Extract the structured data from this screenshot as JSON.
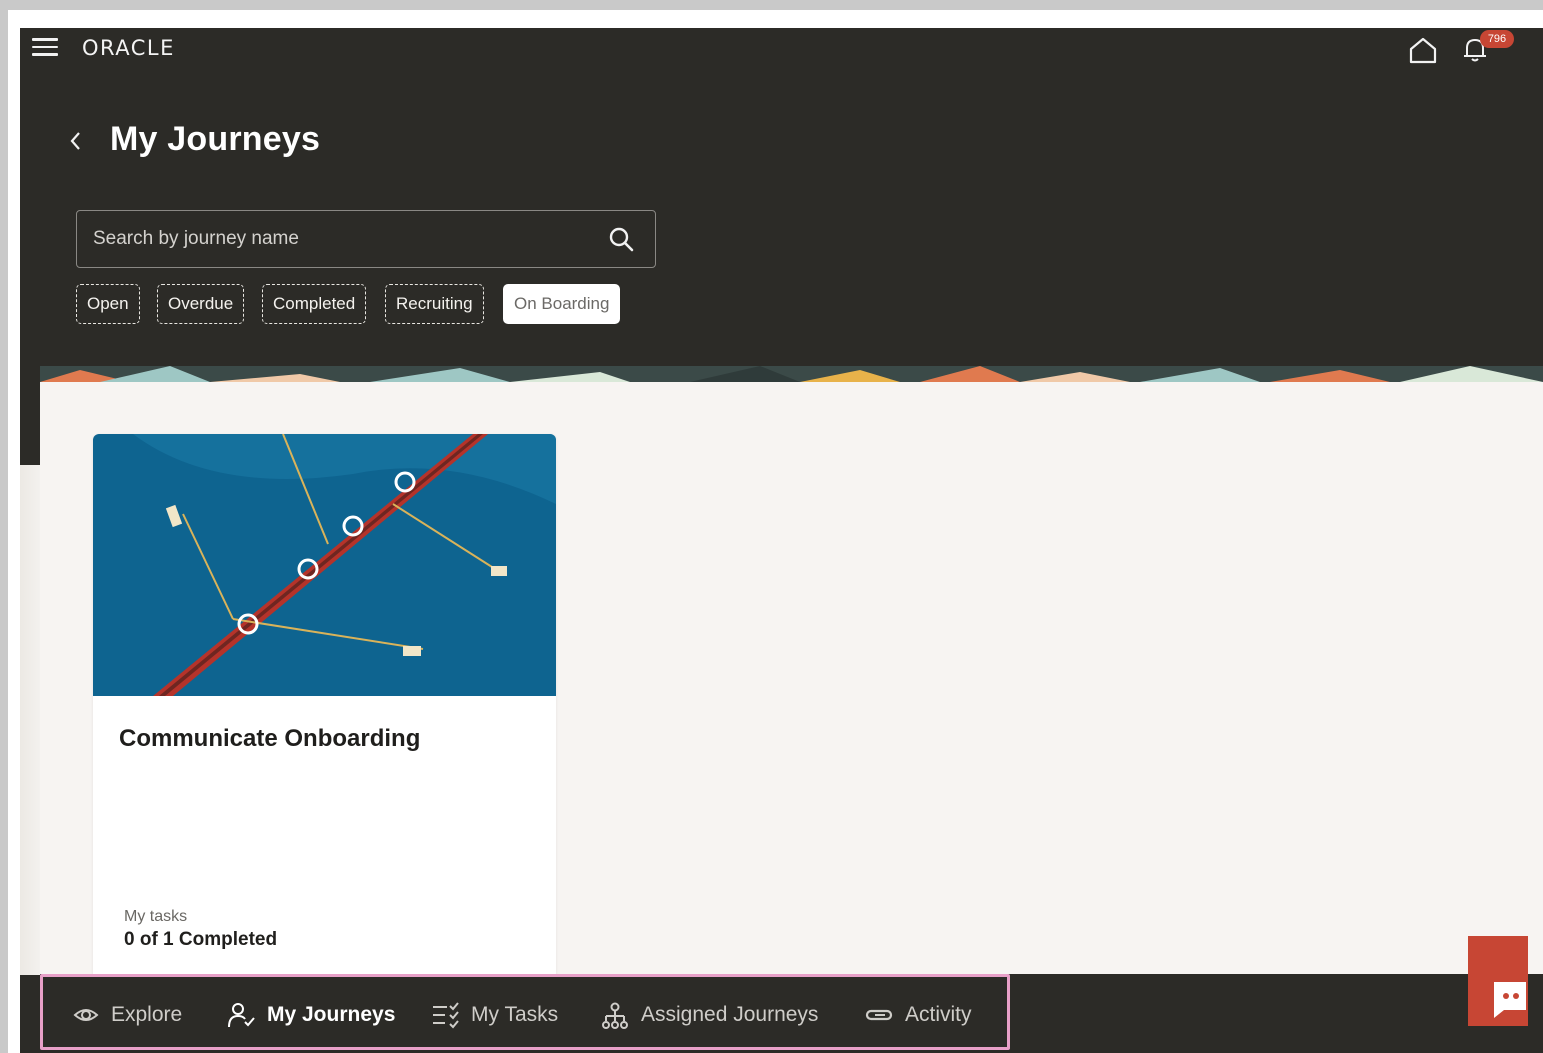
{
  "topbar": {
    "logo_text": "ORACLE",
    "notification_count": "796"
  },
  "header": {
    "title": "My Journeys"
  },
  "search": {
    "placeholder": "Search by journey name"
  },
  "filters": [
    {
      "label": "Open",
      "selected": false
    },
    {
      "label": "Overdue",
      "selected": false
    },
    {
      "label": "Completed",
      "selected": false
    },
    {
      "label": "Recruiting",
      "selected": false
    },
    {
      "label": "On Boarding",
      "selected": true
    }
  ],
  "journey_card": {
    "title": "Communicate Onboarding",
    "tasks_label": "My tasks",
    "tasks_value": "0 of 1 Completed"
  },
  "bottom_nav": [
    {
      "label": "Explore",
      "icon": "eye-icon",
      "active": false
    },
    {
      "label": "My Journeys",
      "icon": "person-journey-icon",
      "active": true
    },
    {
      "label": "My Tasks",
      "icon": "task-list-icon",
      "active": false
    },
    {
      "label": "Assigned Journeys",
      "icon": "hierarchy-icon",
      "active": false
    },
    {
      "label": "Activity",
      "icon": "activity-icon",
      "active": false
    }
  ],
  "colors": {
    "header_bg": "#2c2b27",
    "badge": "#c74634",
    "content_bg": "#f7f4f2",
    "nav_highlight": "#e8a0c8"
  }
}
